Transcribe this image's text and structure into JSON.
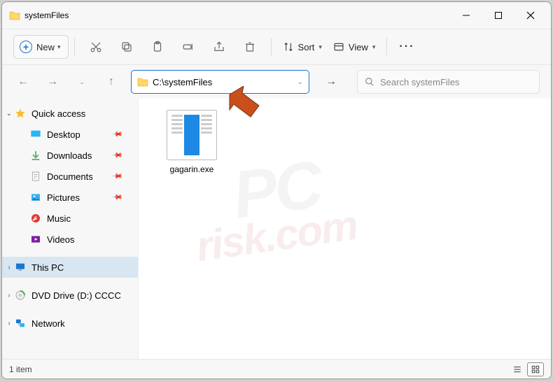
{
  "titlebar": {
    "title": "systemFiles"
  },
  "toolbar": {
    "new_label": "New",
    "sort_label": "Sort",
    "view_label": "View"
  },
  "navbar": {
    "path": "C:\\systemFiles",
    "search_placeholder": "Search systemFiles"
  },
  "sidebar": {
    "quick_access": "Quick access",
    "items": [
      {
        "label": "Desktop",
        "pinned": true
      },
      {
        "label": "Downloads",
        "pinned": true
      },
      {
        "label": "Documents",
        "pinned": true
      },
      {
        "label": "Pictures",
        "pinned": true
      },
      {
        "label": "Music",
        "pinned": false
      },
      {
        "label": "Videos",
        "pinned": false
      }
    ],
    "this_pc": "This PC",
    "dvd": "DVD Drive (D:) CCCC",
    "network": "Network"
  },
  "content": {
    "files": [
      {
        "name": "gagarin.exe"
      }
    ]
  },
  "statusbar": {
    "count_label": "1 item"
  },
  "watermark": {
    "line1": "PC",
    "line2": "risk.com"
  }
}
